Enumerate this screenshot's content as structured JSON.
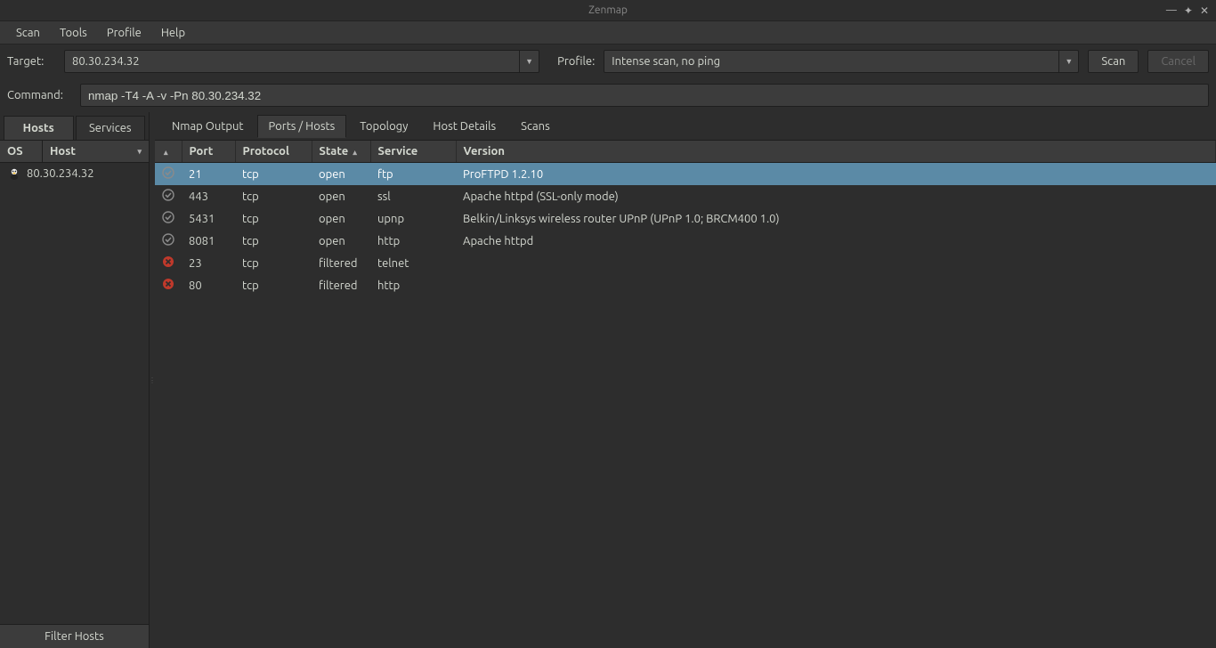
{
  "window": {
    "title": "Zenmap"
  },
  "menubar": [
    "Scan",
    "Tools",
    "Profile",
    "Help"
  ],
  "toolbar": {
    "target_label": "Target:",
    "target_value": "80.30.234.32",
    "profile_label": "Profile:",
    "profile_value": "Intense scan, no ping",
    "scan_label": "Scan",
    "cancel_label": "Cancel"
  },
  "command": {
    "label": "Command:",
    "value": "nmap -T4 -A -v -Pn 80.30.234.32"
  },
  "left": {
    "tabs": {
      "hosts": "Hosts",
      "services": "Services"
    },
    "columns": {
      "os": "OS",
      "host": "Host"
    },
    "hosts": [
      {
        "os_icon": "linux-icon",
        "host": "80.30.234.32"
      }
    ],
    "filter_label": "Filter Hosts"
  },
  "right": {
    "tabs": [
      "Nmap Output",
      "Ports / Hosts",
      "Topology",
      "Host Details",
      "Scans"
    ],
    "active_tab_index": 1,
    "columns": [
      "",
      "Port",
      "Protocol",
      "State",
      "Service",
      "Version"
    ],
    "sort_col_icon_index": 0,
    "sort_col_state_index": 3,
    "rows": [
      {
        "status": "open",
        "port": "21",
        "protocol": "tcp",
        "state": "open",
        "service": "ftp",
        "version": "ProFTPD 1.2.10",
        "selected": true
      },
      {
        "status": "open",
        "port": "443",
        "protocol": "tcp",
        "state": "open",
        "service": "ssl",
        "version": "Apache httpd (SSL-only mode)",
        "selected": false
      },
      {
        "status": "open",
        "port": "5431",
        "protocol": "tcp",
        "state": "open",
        "service": "upnp",
        "version": "Belkin/Linksys wireless router UPnP (UPnP 1.0; BRCM400 1.0)",
        "selected": false
      },
      {
        "status": "open",
        "port": "8081",
        "protocol": "tcp",
        "state": "open",
        "service": "http",
        "version": "Apache httpd",
        "selected": false
      },
      {
        "status": "filtered",
        "port": "23",
        "protocol": "tcp",
        "state": "filtered",
        "service": "telnet",
        "version": "",
        "selected": false
      },
      {
        "status": "filtered",
        "port": "80",
        "protocol": "tcp",
        "state": "filtered",
        "service": "http",
        "version": "",
        "selected": false
      }
    ]
  }
}
